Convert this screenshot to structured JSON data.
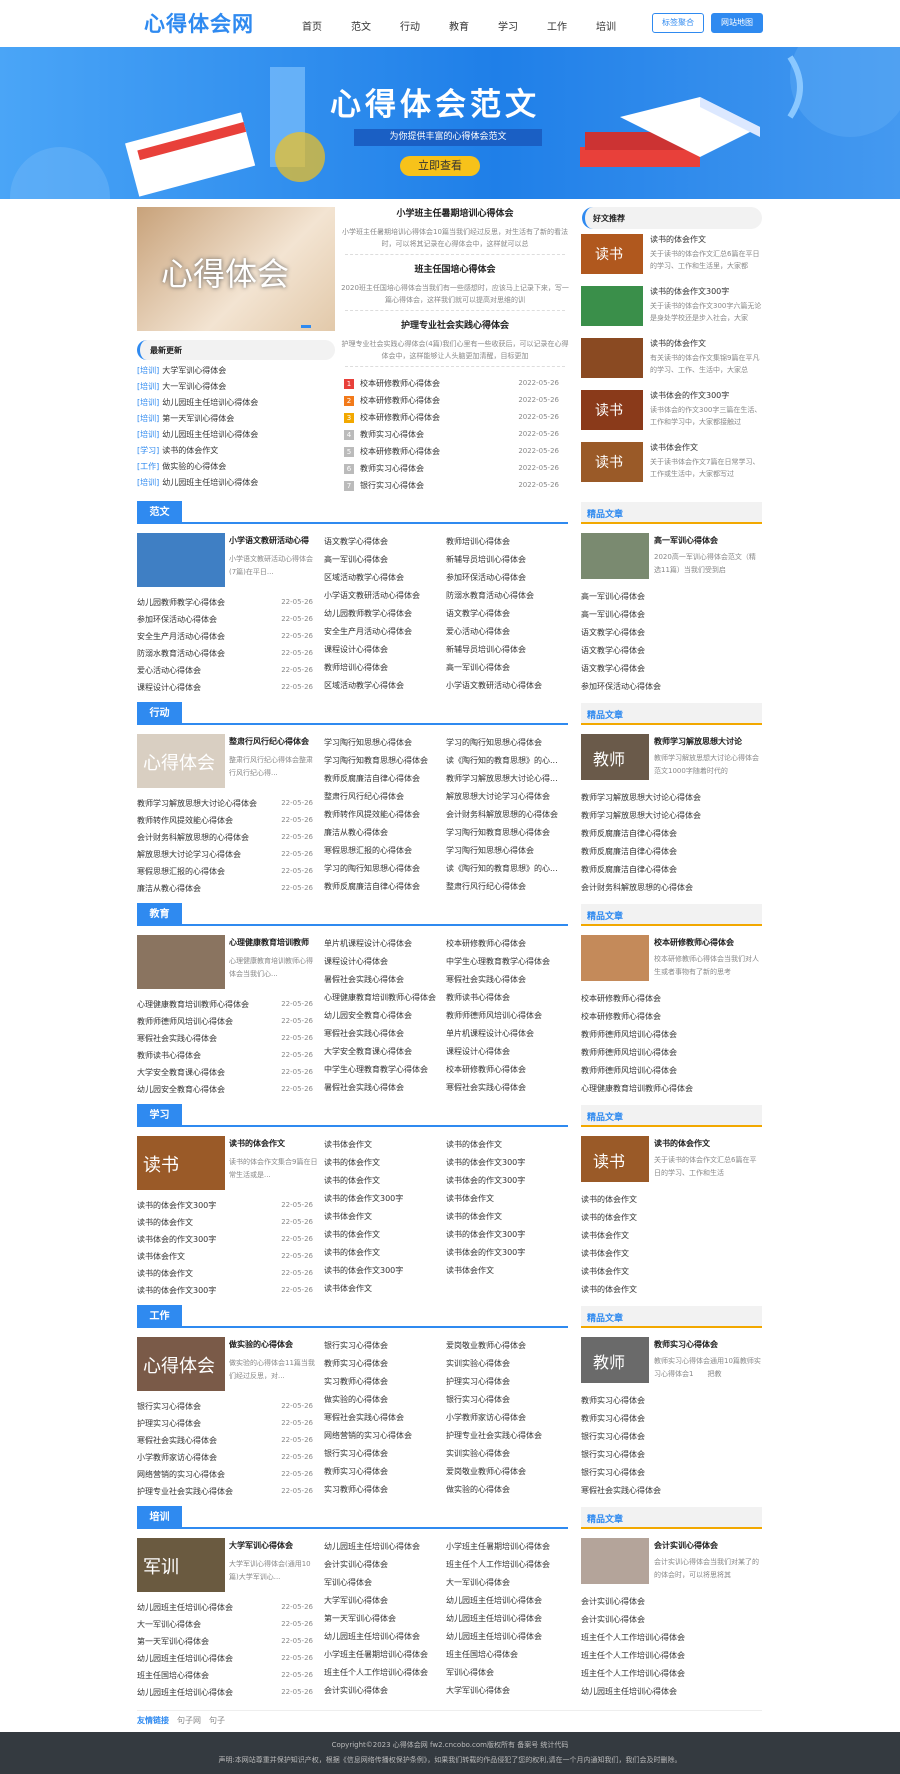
{
  "header": {
    "logo": "心得体会网",
    "nav": [
      "首页",
      "范文",
      "行动",
      "教育",
      "学习",
      "工作",
      "培训"
    ],
    "btn1": "标签聚合",
    "btn2": "网站地图"
  },
  "banner": {
    "title": "心得体会范文",
    "subtitle": "为你提供丰富的心得体会范文",
    "cta": "立即查看"
  },
  "top": {
    "slide_text": "心得体会",
    "latest_title": "最新更新",
    "latest": [
      [
        "[培训]",
        "大学军训心得体会"
      ],
      [
        "[培训]",
        "大一军训心得体会"
      ],
      [
        "[培训]",
        "幼儿园班主任培训心得体会"
      ],
      [
        "[培训]",
        "第一天军训心得体会"
      ],
      [
        "[培训]",
        "幼儿园班主任培训心得体会"
      ],
      [
        "[学习]",
        "读书的体会作文"
      ],
      [
        "[工作]",
        "做实验的心得体会"
      ],
      [
        "[培训]",
        "幼儿园班主任培训心得体会"
      ]
    ],
    "features": [
      {
        "title": "小学班主任暑期培训心得体会",
        "desc": "小学班主任暑期培训心得体会10篇当我们经过反思，对生活有了新的看法时，可以将其记录在心得体会中，这样就可以总"
      },
      {
        "title": "班主任国培心得体会",
        "desc": "2020班主任国培心得体会当我们有一些感想时，应该马上记录下来，写一篇心得体会，这样我们就可以提高对思维的训"
      },
      {
        "title": "护理专业社会实践心得体会",
        "desc": "护理专业社会实践心得体会(4篇)我们心里有一些收获后，可以记录在心得体会中，这样能够让人头脑更加清醒，目标更加"
      }
    ],
    "ranked": [
      [
        "校本研修教师心得体会",
        "2022-05-26"
      ],
      [
        "校本研修教师心得体会",
        "2022-05-26"
      ],
      [
        "校本研修教师心得体会",
        "2022-05-26"
      ],
      [
        "教师实习心得体会",
        "2022-05-26"
      ],
      [
        "校本研修教师心得体会",
        "2022-05-26"
      ],
      [
        "教师实习心得体会",
        "2022-05-26"
      ],
      [
        "银行实习心得体会",
        "2022-05-26"
      ]
    ],
    "rec_title": "好文推荐",
    "recs": [
      {
        "img": "读书",
        "title": "读书的体会作文",
        "desc": "关于读书的体会作文汇总6篇在平日的学习、工作和生活里，大家都"
      },
      {
        "img": "",
        "title": "读书的体会作文300字",
        "desc": "关于读书的体会作文300字六篇无论是身处学校还是步入社会，大家"
      },
      {
        "img": "",
        "title": "读书的体会作文",
        "desc": "有关读书的体会作文集锦9篇在平凡的学习、工作、生活中，大家总"
      },
      {
        "img": "读书",
        "title": "读书体会的作文300字",
        "desc": "读书体会的作文300字三篇在生活、工作和学习中，大家都接触过"
      },
      {
        "img": "读书",
        "title": "读书体会作文",
        "desc": "关于读书体会作文7篇在日常学习、工作或生活中，大家都写过"
      }
    ]
  },
  "sections": [
    {
      "label": "范文",
      "img": "",
      "feat_title": "小学语文教研活动心得",
      "feat_desc": "小学语文教研活动心得体会(7篇)在平日...",
      "left": [
        "幼儿园教师教学心得体会",
        "参加环保活动心得体会",
        "安全生产月活动心得体会",
        "防溺水教育活动心得体会",
        "爱心活动心得体会",
        "课程设计心得体会"
      ],
      "dates": [
        "22-05-26",
        "22-05-26",
        "22-05-26",
        "22-05-26",
        "22-05-26",
        "22-05-26"
      ],
      "c2": [
        "语文教学心得体会",
        "高一军训心得体会",
        "区域活动教学心得体会",
        "小学语文教研活动心得体会",
        "幼儿园教师教学心得体会",
        "安全生产月活动心得体会",
        "课程设计心得体会",
        "教师培训心得体会",
        "区域活动教学心得体会"
      ],
      "c3": [
        "教师培训心得体会",
        "新辅导员培训心得体会",
        "参加环保活动心得体会",
        "防溺水教育活动心得体会",
        "语文教学心得体会",
        "爱心活动心得体会",
        "新辅导员培训心得体会",
        "高一军训心得体会",
        "小学语文教研活动心得体会"
      ],
      "side_img": "",
      "side_title": "高一军训心得体会",
      "side_desc": "2020高一军训心得体会范文（精选11篇）当我们受到启",
      "side": [
        "高一军训心得体会",
        "高一军训心得体会",
        "语文教学心得体会",
        "语文教学心得体会",
        "语文教学心得体会",
        "参加环保活动心得体会"
      ]
    },
    {
      "label": "行动",
      "img": "心得体会",
      "feat_title": "整肃行风行纪心得体会",
      "feat_desc": "整肃行风行纪心得体会整肃行风行纪心得...",
      "left": [
        "教师学习解放思想大讨论心得体会",
        "教师转作风提效能心得体会",
        "会计财务科解放思想的心得体会",
        "解放思想大讨论学习心得体会",
        "寒假思想汇报的心得体会",
        "廉洁从教心得体会"
      ],
      "dates": [
        "22-05-26",
        "22-05-26",
        "22-05-26",
        "22-05-26",
        "22-05-26",
        "22-05-26"
      ],
      "c2": [
        "学习陶行知思想心得体会",
        "学习陶行知教育思想心得体会",
        "教师反腐廉洁自律心得体会",
        "整肃行风行纪心得体会",
        "教师转作风提效能心得体会",
        "廉洁从教心得体会",
        "寒假思想汇报的心得体会",
        "学习的陶行知思想心得体会",
        "教师反腐廉洁自律心得体会"
      ],
      "c3": [
        "学习的陶行知思想心得体会",
        "读《陶行知的教育思想》的心...",
        "教师学习解放思想大讨论心得...",
        "解放思想大讨论学习心得体会",
        "会计财务科解放思想的心得体会",
        "学习陶行知教育思想心得体会",
        "学习陶行知思想心得体会",
        "读《陶行知的教育思想》的心...",
        "整肃行风行纪心得体会"
      ],
      "side_img": "教师",
      "side_title": "教师学习解放思想大讨论",
      "side_desc": "教师学习解放思想大讨论心得体会范文1000字随着时代的",
      "side": [
        "教师学习解放思想大讨论心得体会",
        "教师学习解放思想大讨论心得体会",
        "教师反腐廉洁自律心得体会",
        "教师反腐廉洁自律心得体会",
        "教师反腐廉洁自律心得体会",
        "会计财务科解放思想的心得体会"
      ]
    },
    {
      "label": "教育",
      "img": "",
      "feat_title": "心理健康教育培训教师",
      "feat_desc": "心理健康教育培训教师心得体会当我们心...",
      "left": [
        "心理健康教育培训教师心得体会",
        "教师师德师风培训心得体会",
        "寒假社会实践心得体会",
        "教师读书心得体会",
        "大学安全教育课心得体会",
        "幼儿园安全教育心得体会"
      ],
      "dates": [
        "22-05-26",
        "22-05-26",
        "22-05-26",
        "22-05-26",
        "22-05-26",
        "22-05-26"
      ],
      "c2": [
        "单片机课程设计心得体会",
        "课程设计心得体会",
        "暑假社会实践心得体会",
        "心理健康教育培训教师心得体会",
        "幼儿园安全教育心得体会",
        "寒假社会实践心得体会",
        "大学安全教育课心得体会",
        "中学生心理教育教学心得体会",
        "暑假社会实践心得体会"
      ],
      "c3": [
        "校本研修教师心得体会",
        "中学生心理教育教学心得体会",
        "寒假社会实践心得体会",
        "教师读书心得体会",
        "教师师德师风培训心得体会",
        "单片机课程设计心得体会",
        "课程设计心得体会",
        "校本研修教师心得体会",
        "寒假社会实践心得体会"
      ],
      "side_img": "",
      "side_title": "校本研修教师心得体会",
      "side_desc": "校本研修教师心得体会当我们对人生或者事物有了新的思考",
      "side": [
        "校本研修教师心得体会",
        "校本研修教师心得体会",
        "教师师德师风培训心得体会",
        "教师师德师风培训心得体会",
        "教师师德师风培训心得体会",
        "心理健康教育培训教师心得体会"
      ]
    },
    {
      "label": "学习",
      "img": "读书",
      "feat_title": "读书的体会作文",
      "feat_desc": "读书的体会作文集合9篇在日常生活或是...",
      "left": [
        "读书的体会作文300字",
        "读书的体会作文",
        "读书体会的作文300字",
        "读书体会作文",
        "读书的体会作文",
        "读书的体会作文300字"
      ],
      "dates": [
        "22-05-26",
        "22-05-26",
        "22-05-26",
        "22-05-26",
        "22-05-26",
        "22-05-26"
      ],
      "c2": [
        "读书体会作文",
        "读书的体会作文",
        "读书的体会作文",
        "读书的体会作文300字",
        "读书体会作文",
        "读书的体会作文",
        "读书的体会作文",
        "读书的体会作文300字",
        "读书体会作文"
      ],
      "c3": [
        "读书的体会作文",
        "读书的体会作文300字",
        "读书体会的作文300字",
        "读书体会作文",
        "读书的体会作文",
        "读书的体会作文300字",
        "读书体会的作文300字",
        "读书体会作文"
      ],
      "side_img": "读书",
      "side_title": "读书的体会作文",
      "side_desc": "关于读书的体会作文汇总6篇在平日的学习、工作和生活",
      "side": [
        "读书的体会作文",
        "读书的体会作文",
        "读书体会作文",
        "读书体会作文",
        "读书体会作文",
        "读书的体会作文"
      ]
    },
    {
      "label": "工作",
      "img": "心得体会",
      "feat_title": "做实验的心得体会",
      "feat_desc": "做实验的心得体会11篇当我们经过反思，对...",
      "left": [
        "银行实习心得体会",
        "护理实习心得体会",
        "寒假社会实践心得体会",
        "小学教师家访心得体会",
        "网络营销的实习心得体会",
        "护理专业社会实践心得体会"
      ],
      "dates": [
        "22-05-26",
        "22-05-26",
        "22-05-26",
        "22-05-26",
        "22-05-26",
        "22-05-26"
      ],
      "c2": [
        "银行实习心得体会",
        "教师实习心得体会",
        "实习教师心得体会",
        "做实验的心得体会",
        "寒假社会实践心得体会",
        "网络营销的实习心得体会",
        "银行实习心得体会",
        "教师实习心得体会",
        "实习教师心得体会"
      ],
      "c3": [
        "爱岗敬业教师心得体会",
        "实训实验心得体会",
        "护理实习心得体会",
        "银行实习心得体会",
        "小学教师家访心得体会",
        "护理专业社会实践心得体会",
        "实训实验心得体会",
        "爱岗敬业教师心得体会",
        "做实验的心得体会"
      ],
      "side_img": "教师",
      "side_title": "教师实习心得体会",
      "side_desc": "教师实习心得体会通用10篇教师实习心得体会1　　把教",
      "side": [
        "教师实习心得体会",
        "教师实习心得体会",
        "银行实习心得体会",
        "银行实习心得体会",
        "银行实习心得体会",
        "寒假社会实践心得体会"
      ]
    },
    {
      "label": "培训",
      "img": "军训",
      "feat_title": "大学军训心得体会",
      "feat_desc": "大学军训心得体会(通用10篇)大学军训心...",
      "left": [
        "幼儿园班主任培训心得体会",
        "大一军训心得体会",
        "第一天军训心得体会",
        "幼儿园班主任培训心得体会",
        "班主任国培心得体会",
        "幼儿园班主任培训心得体会"
      ],
      "dates": [
        "22-05-26",
        "22-05-26",
        "22-05-26",
        "22-05-26",
        "22-05-26",
        "22-05-26"
      ],
      "c2": [
        "幼儿园班主任培训心得体会",
        "会计实训心得体会",
        "军训心得体会",
        "大学军训心得体会",
        "第一天军训心得体会",
        "幼儿园班主任培训心得体会",
        "小学班主任暑期培训心得体会",
        "班主任个人工作培训心得体会",
        "会计实训心得体会"
      ],
      "c3": [
        "小学班主任暑期培训心得体会",
        "班主任个人工作培训心得体会",
        "大一军训心得体会",
        "幼儿园班主任培训心得体会",
        "幼儿园班主任培训心得体会",
        "幼儿园班主任培训心得体会",
        "班主任国培心得体会",
        "军训心得体会",
        "大学军训心得体会"
      ],
      "side_img": "",
      "side_title": "会计实训心得体会",
      "side_desc": "会计实训心得体会当我们对某了的的体会时，可以将思将其",
      "side": [
        "会计实训心得体会",
        "会计实训心得体会",
        "班主任个人工作培训心得体会",
        "班主任个人工作培训心得体会",
        "班主任个人工作培训心得体会",
        "幼儿园班主任培训心得体会"
      ]
    }
  ],
  "side_label": "精品文章",
  "links": {
    "label": "友情链接",
    "items": [
      "句子网",
      "句子"
    ]
  },
  "footer": {
    "line1": "Copyright©2023 心得体会网 fw2.cncobo.com版权所有 备案号 统计代码",
    "line2": "声明:本网站尊重并保护知识产权，根据《信息网络传播权保护条例》，如果我们转载的作品侵犯了您的权利,请在一个月内通知我们，我们会及时删除。"
  }
}
